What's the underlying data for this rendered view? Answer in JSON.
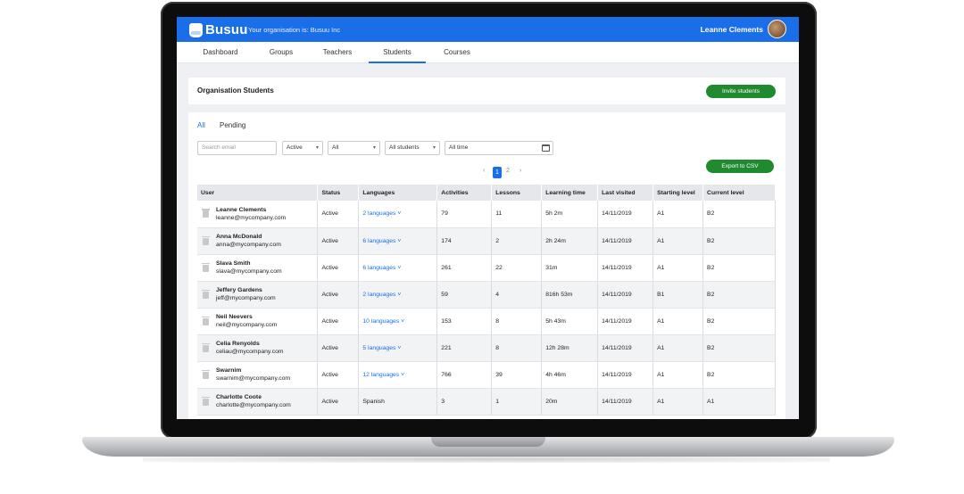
{
  "header": {
    "logo_text": "Busuu",
    "org_text": "Your organisation is: Busuu Inc",
    "user_name": "Leanne Clements",
    "brand_color": "#1a6ee8"
  },
  "nav": {
    "tabs": [
      {
        "label": "Dashboard"
      },
      {
        "label": "Groups"
      },
      {
        "label": "Teachers"
      },
      {
        "label": "Students",
        "active": true
      },
      {
        "label": "Courses"
      }
    ]
  },
  "page": {
    "title": "Organisation Students",
    "invite_label": "Invite students",
    "export_label": "Export to CSV",
    "accent_green": "#1f8b2e"
  },
  "subtabs": [
    {
      "label": "All",
      "active": true
    },
    {
      "label": "Pending"
    }
  ],
  "filters": {
    "search_placeholder": "Search email",
    "status": "Active",
    "language": "All",
    "students": "All students",
    "time": "All time"
  },
  "pagination": {
    "prev": "‹",
    "pages": [
      "1",
      "2"
    ],
    "current": "1",
    "next": "›"
  },
  "table": {
    "columns": [
      "User",
      "Status",
      "Languages",
      "Activities",
      "Lessons",
      "Learning time",
      "Last visited",
      "Starting level",
      "Current level"
    ],
    "rows": [
      {
        "name": "Leanne Clements",
        "email": "leanne@mycompany.com",
        "status": "Active",
        "languages": "2 languages",
        "activities": "79",
        "lessons": "11",
        "time": "5h 2m",
        "last": "14/11/2019",
        "start": "A1",
        "current": "B2"
      },
      {
        "name": "Anna McDonald",
        "email": "anna@mycompany.com",
        "status": "Active",
        "languages": "6 languages",
        "activities": "174",
        "lessons": "2",
        "time": "2h 24m",
        "last": "14/11/2019",
        "start": "A1",
        "current": "B2"
      },
      {
        "name": "Slava Smith",
        "email": "slava@mycompany.com",
        "status": "Active",
        "languages": "6 languages",
        "activities": "261",
        "lessons": "22",
        "time": "31m",
        "last": "14/11/2019",
        "start": "A1",
        "current": "B2"
      },
      {
        "name": "Jeffery Gardens",
        "email": "jeff@mycompany.com",
        "status": "Active",
        "languages": "2 languages",
        "activities": "59",
        "lessons": "4",
        "time": "816h 53m",
        "last": "14/11/2019",
        "start": "B1",
        "current": "B2"
      },
      {
        "name": "Neil Neevers",
        "email": "neil@mycompany.com",
        "status": "Active",
        "languages": "10 languages",
        "activities": "153",
        "lessons": "8",
        "time": "5h 43m",
        "last": "14/11/2019",
        "start": "A1",
        "current": "B2"
      },
      {
        "name": "Celia Renyolds",
        "email": "celiau@mycompany.com",
        "status": "Active",
        "languages": "5 languages",
        "activities": "221",
        "lessons": "8",
        "time": "12h 28m",
        "last": "14/11/2019",
        "start": "A1",
        "current": "B2"
      },
      {
        "name": "Swarnim",
        "email": "swarnim@mycompany.com",
        "status": "Active",
        "languages": "12 languages",
        "activities": "766",
        "lessons": "39",
        "time": "4h 46m",
        "last": "14/11/2019",
        "start": "A1",
        "current": "B2"
      },
      {
        "name": "Charlotte Coote",
        "email": "charlotte@mycompany.com",
        "status": "Active",
        "languages": "Spanish",
        "activities": "3",
        "lessons": "1",
        "time": "20m",
        "last": "14/11/2019",
        "start": "A1",
        "current": "A1"
      }
    ]
  }
}
